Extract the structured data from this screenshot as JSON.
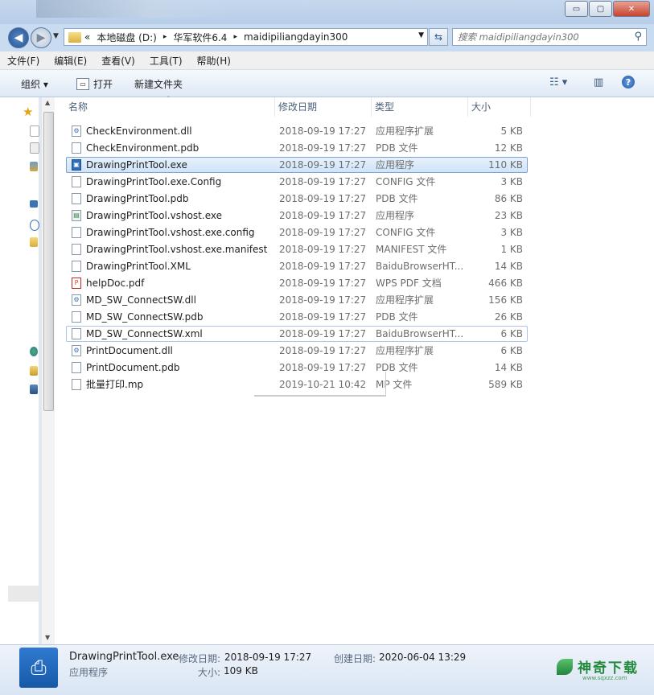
{
  "window": {
    "min_symbol": "▭",
    "max_symbol": "▢",
    "close_symbol": "✕"
  },
  "address": {
    "crumbs": [
      "«",
      "本地磁盘 (D:)",
      "华军软件6.4",
      "maidipiliangdayin300"
    ],
    "separator": "▸"
  },
  "search": {
    "placeholder": "搜索 maidipiliangdayin300"
  },
  "menu": [
    "文件(F)",
    "编辑(E)",
    "查看(V)",
    "工具(T)",
    "帮助(H)"
  ],
  "toolbar": {
    "organize": "组织 ▾",
    "open": "打开",
    "new_folder": "新建文件夹"
  },
  "columns": {
    "name": "名称",
    "date": "修改日期",
    "type": "类型",
    "size": "大小"
  },
  "files": [
    {
      "name": "CheckEnvironment.dll",
      "date": "2018-09-19 17:27",
      "type": "应用程序扩展",
      "size": "5 KB",
      "icon": "dll-icon"
    },
    {
      "name": "CheckEnvironment.pdb",
      "date": "2018-09-19 17:27",
      "type": "PDB 文件",
      "size": "12 KB",
      "icon": "file-icon"
    },
    {
      "name": "DrawingPrintTool.exe",
      "date": "2018-09-19 17:27",
      "type": "应用程序",
      "size": "110 KB",
      "icon": "exe-icon",
      "selected": true
    },
    {
      "name": "DrawingPrintTool.exe.Config",
      "date": "2018-09-19 17:27",
      "type": "CONFIG 文件",
      "size": "3 KB",
      "icon": "file-icon"
    },
    {
      "name": "DrawingPrintTool.pdb",
      "date": "2018-09-19 17:27",
      "type": "PDB 文件",
      "size": "86 KB",
      "icon": "file-icon"
    },
    {
      "name": "DrawingPrintTool.vshost.exe",
      "date": "2018-09-19 17:27",
      "type": "应用程序",
      "size": "23 KB",
      "icon": "vshost-icon"
    },
    {
      "name": "DrawingPrintTool.vshost.exe.config",
      "date": "2018-09-19 17:27",
      "type": "CONFIG 文件",
      "size": "3 KB",
      "icon": "file-icon"
    },
    {
      "name": "DrawingPrintTool.vshost.exe.manifest",
      "date": "2018-09-19 17:27",
      "type": "MANIFEST 文件",
      "size": "1 KB",
      "icon": "file-icon"
    },
    {
      "name": "DrawingPrintTool.XML",
      "date": "2018-09-19 17:27",
      "type": "BaiduBrowserHT...",
      "size": "14 KB",
      "icon": "file-icon"
    },
    {
      "name": "helpDoc.pdf",
      "date": "2018-09-19 17:27",
      "type": "WPS PDF 文档",
      "size": "466 KB",
      "icon": "pdf-icon"
    },
    {
      "name": "MD_SW_ConnectSW.dll",
      "date": "2018-09-19 17:27",
      "type": "应用程序扩展",
      "size": "156 KB",
      "icon": "dll-icon"
    },
    {
      "name": "MD_SW_ConnectSW.pdb",
      "date": "2018-09-19 17:27",
      "type": "PDB 文件",
      "size": "26 KB",
      "icon": "file-icon"
    },
    {
      "name": "MD_SW_ConnectSW.xml",
      "date": "2018-09-19 17:27",
      "type": "BaiduBrowserHT...",
      "size": "6 KB",
      "icon": "file-icon",
      "focused": true
    },
    {
      "name": "PrintDocument.dll",
      "date": "2018-09-19 17:27",
      "type": "应用程序扩展",
      "size": "6 KB",
      "icon": "dll-icon"
    },
    {
      "name": "PrintDocument.pdb",
      "date": "2018-09-19 17:27",
      "type": "PDB 文件",
      "size": "14 KB",
      "icon": "file-icon"
    },
    {
      "name": "批量打印.mp",
      "date": "2019-10-21 10:42",
      "type": "MP 文件",
      "size": "589 KB",
      "icon": "file-icon"
    }
  ],
  "details": {
    "filename": "DrawingPrintTool.exe",
    "filetype": "应用程序",
    "modified_label": "修改日期:",
    "modified_value": "2018-09-19 17:27",
    "created_label": "创建日期:",
    "created_value": "2020-06-04 13:29",
    "size_label": "大小:",
    "size_value": "109 KB"
  },
  "watermark": {
    "text": "神奇下载",
    "sub": "www.sqxzz.com"
  },
  "colors": {
    "selection": "#cfe4fa",
    "selection_border": "#7da2ce",
    "watermark": "#238a3d"
  }
}
